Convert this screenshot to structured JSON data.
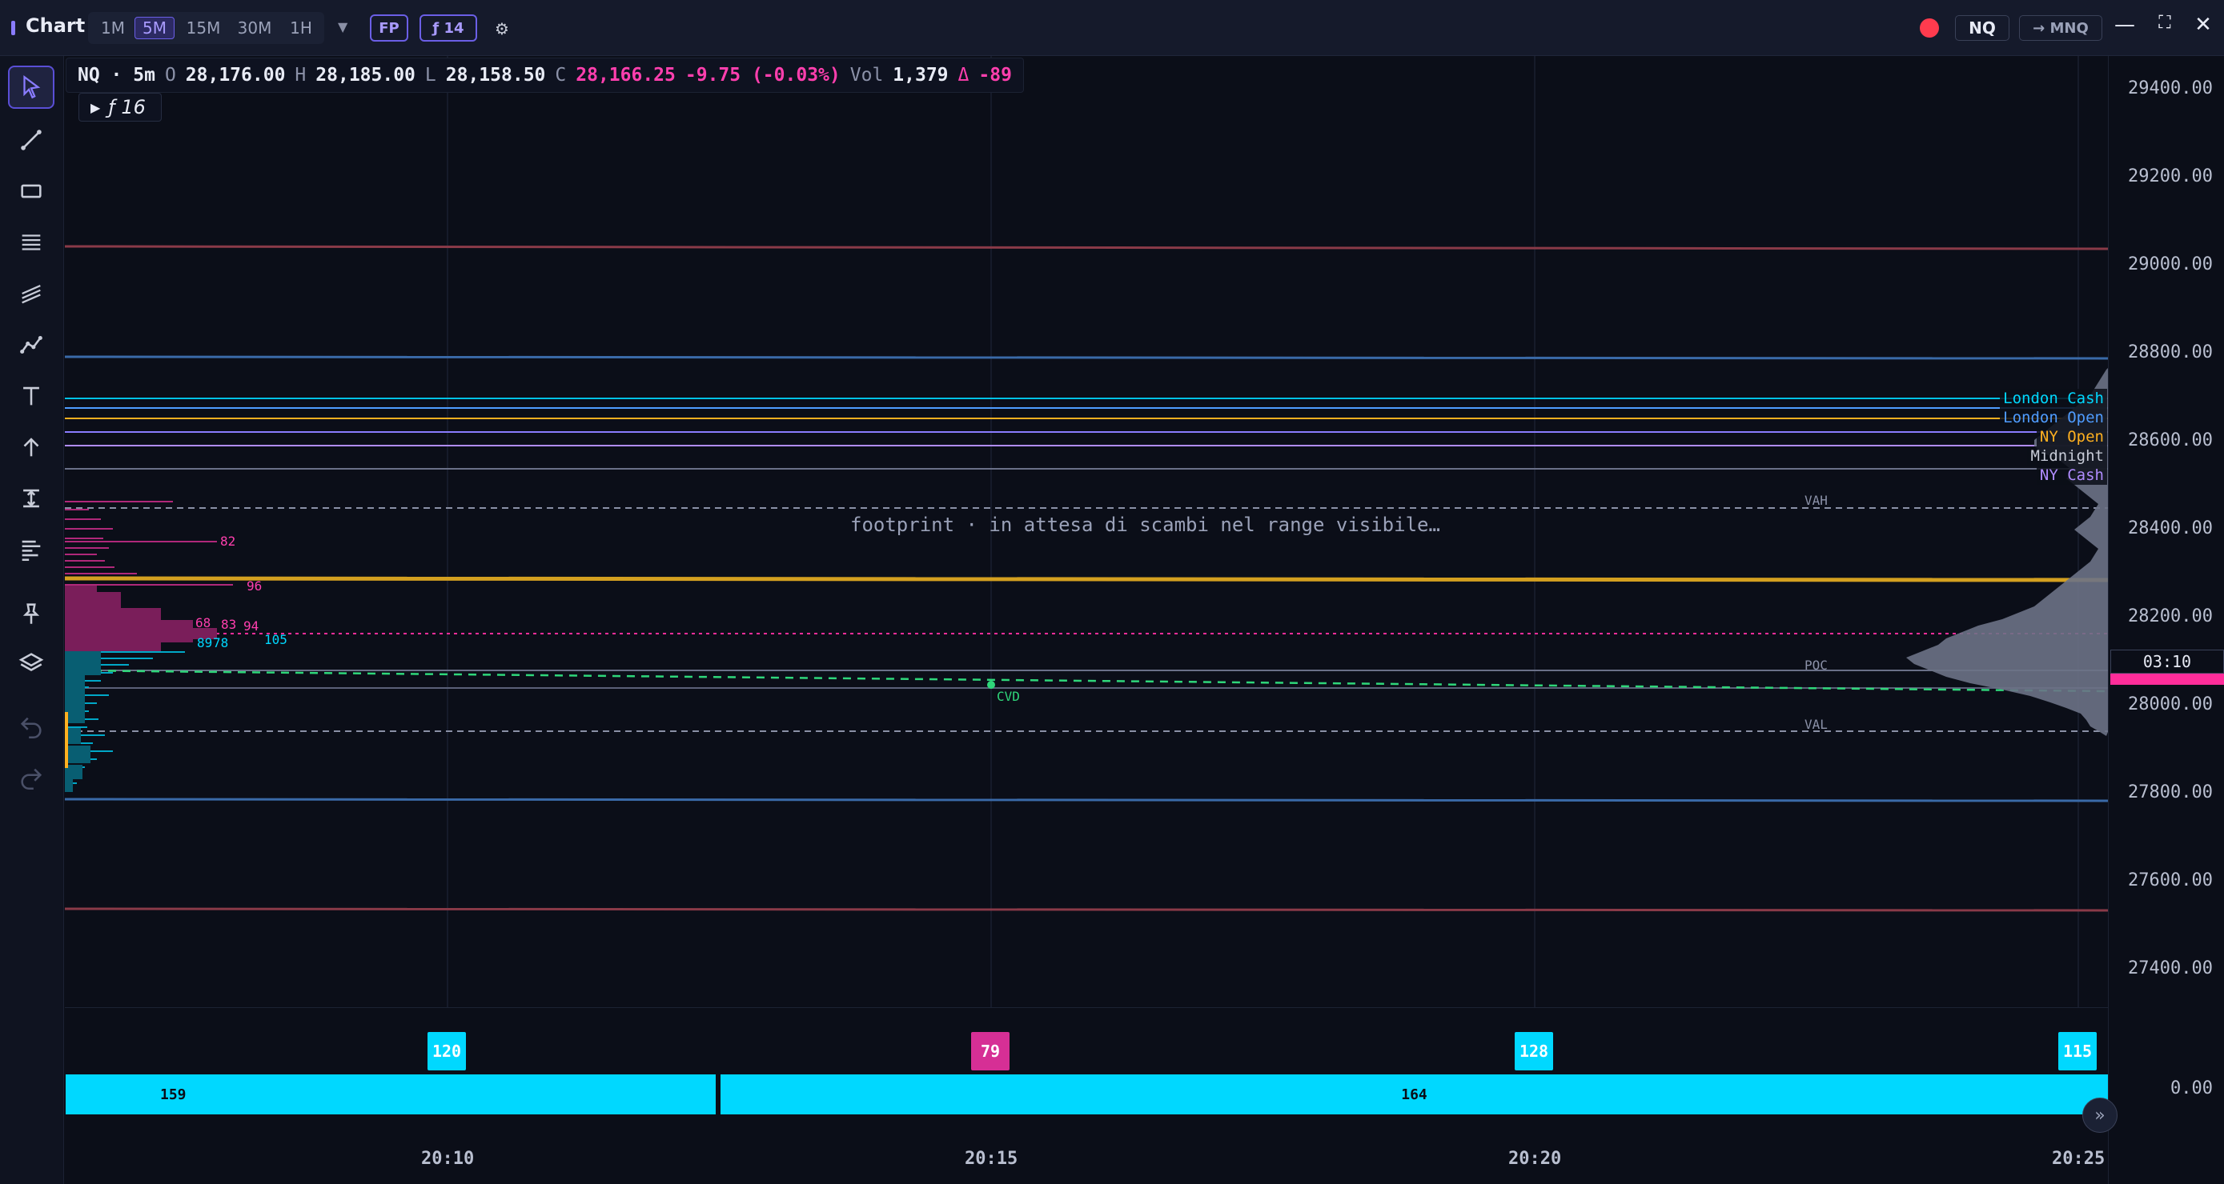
{
  "app": {
    "title": "Chart"
  },
  "timeframes": [
    "1M",
    "5M",
    "15M",
    "30M",
    "1H"
  ],
  "active_timeframe": "5M",
  "toolbar": {
    "fp_label": "FP",
    "indicators_label": "ƒ 14"
  },
  "symbol": {
    "primary": "NQ",
    "secondary": "→ MNQ"
  },
  "ohlc": {
    "symbol_tf": "NQ · 5m",
    "o_label": "O",
    "o": "28,176.00",
    "h_label": "H",
    "h": "28,185.00",
    "l_label": "L",
    "l": "28,158.50",
    "c_label": "C",
    "c": "28,166.25",
    "change": "-9.75 (-0.03%)",
    "vol_label": "Vol",
    "vol": "1,379",
    "delta_label": "Δ",
    "delta": "-89"
  },
  "indicator_toggle": "ƒ 16",
  "status_message": "footprint · in attesa di scambi nel range visibile…",
  "price_axis": [
    "29400.00",
    "29200.00",
    "29000.00",
    "28800.00",
    "28600.00",
    "28400.00",
    "28200.00",
    "28000.00",
    "27800.00",
    "27600.00",
    "27400.00"
  ],
  "volume_axis": "0.00",
  "time_axis": [
    "20:10",
    "20:15",
    "20:20",
    "20:25"
  ],
  "countdown": "03:10",
  "session_levels": [
    {
      "name": "London Cash",
      "color": "#00d8ff"
    },
    {
      "name": "London Open",
      "color": "#4f9cff"
    },
    {
      "name": "NY Open",
      "color": "#ffb020"
    },
    {
      "name": "Midnight",
      "color": "#c8ccd8"
    },
    {
      "name": "NY Cash",
      "color": "#b08cff"
    }
  ],
  "profile_tags": {
    "vah": "VAH",
    "poc": "POC",
    "val": "VAL",
    "cvd": "CVD"
  },
  "footprint_numbers": [
    "82",
    "96",
    "68",
    "83",
    "94",
    "105",
    "89",
    "78"
  ],
  "volume_bars": {
    "top": [
      {
        "value": "120",
        "color": "#00d8ff"
      },
      {
        "value": "79",
        "color": "#d62f95"
      },
      {
        "value": "128",
        "color": "#00d8ff"
      },
      {
        "value": "115",
        "color": "#00d8ff"
      }
    ],
    "bottom": [
      {
        "value": "159"
      },
      {
        "value": "164"
      }
    ]
  },
  "colors": {
    "accent": "#6b5fe6",
    "cyan": "#00d8ff",
    "magenta": "#ff2d9a",
    "bg": "#0b0e18"
  }
}
